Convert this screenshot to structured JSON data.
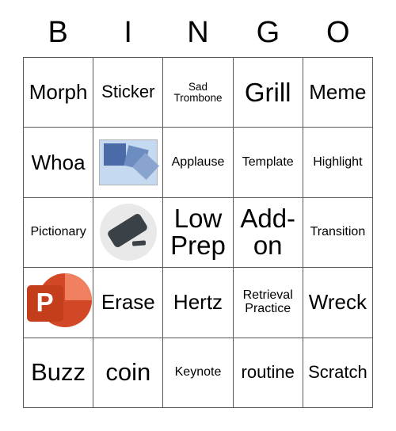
{
  "card": {
    "title": "BINGO",
    "header_letters": [
      "B",
      "I",
      "N",
      "G",
      "O"
    ],
    "grid_size": "5x5",
    "border_color": "#595959",
    "background_color": "#ffffff",
    "rows": [
      [
        {
          "label": "Morph",
          "kind": "text"
        },
        {
          "label": "Sticker",
          "kind": "text"
        },
        {
          "label": "Sad Trombone",
          "kind": "text"
        },
        {
          "label": "Grill",
          "kind": "text"
        },
        {
          "label": "Meme",
          "kind": "text"
        }
      ],
      [
        {
          "label": "Whoa",
          "kind": "text"
        },
        {
          "label": "",
          "kind": "image",
          "icon": "cascading-squares-image"
        },
        {
          "label": "Applause",
          "kind": "text"
        },
        {
          "label": "Template",
          "kind": "text"
        },
        {
          "label": "Highlight",
          "kind": "text"
        }
      ],
      [
        {
          "label": "Pictionary",
          "kind": "text"
        },
        {
          "label": "",
          "kind": "image",
          "icon": "eraser-icon"
        },
        {
          "label": "Low Prep",
          "kind": "text"
        },
        {
          "label": "Add-on",
          "kind": "text"
        },
        {
          "label": "Transition",
          "kind": "text"
        }
      ],
      [
        {
          "label": "",
          "kind": "image",
          "icon": "powerpoint-icon"
        },
        {
          "label": "Erase",
          "kind": "text"
        },
        {
          "label": "Hertz",
          "kind": "text"
        },
        {
          "label": "Retrieval Practice",
          "kind": "text"
        },
        {
          "label": "Wreck",
          "kind": "text"
        }
      ],
      [
        {
          "label": "Buzz",
          "kind": "text"
        },
        {
          "label": "coin",
          "kind": "text"
        },
        {
          "label": "Keynote",
          "kind": "text"
        },
        {
          "label": "routine",
          "kind": "text"
        },
        {
          "label": "Scratch",
          "kind": "text"
        }
      ]
    ]
  },
  "icons": {
    "powerpoint": {
      "letter": "P",
      "tile_color": "#c43e1c",
      "circle_color": "#d24726",
      "highlight_color": "#f08060"
    },
    "eraser": {
      "body_color": "#3b4247",
      "circle_color": "#e9e9e9"
    },
    "cascading_squares": {
      "bg_color": "#c5daf0",
      "square1": "#4a6ba8",
      "square2": "#6d8dc0",
      "square3": "#89a5cf"
    }
  }
}
